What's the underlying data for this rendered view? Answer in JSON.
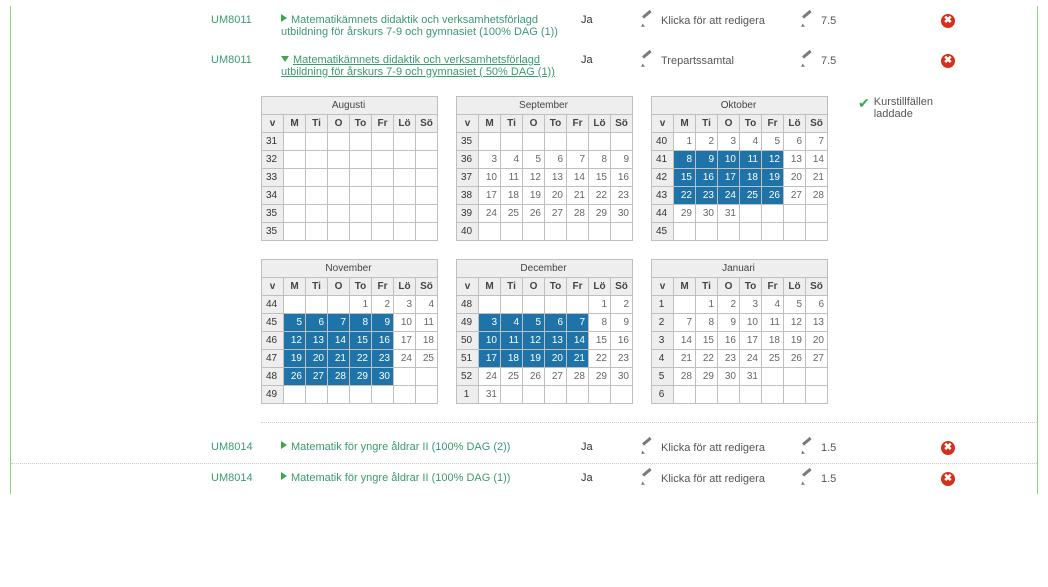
{
  "rows": {
    "r1": {
      "code": "UM8011",
      "title": "Matematikämnets didaktik och verksamhetsförlagd utbildning för årskurs 7-9 och gymnasiet (100% DAG (1))",
      "ja": "Ja",
      "action": "Klicka för att redigera",
      "hp": "7.5"
    },
    "r2": {
      "code": "UM8011",
      "title": "Matematikämnets didaktik och verksamhetsförlagd utbildning för årskurs 7-9 och gymnasiet ( 50% DAG (1))",
      "ja": "Ja",
      "action": "Trepartssamtal",
      "hp": "7.5"
    },
    "r3": {
      "code": "UM8014",
      "title": "Matematik för yngre åldrar II (100% DAG (2))",
      "ja": "Ja",
      "action": "Klicka för att redigera",
      "hp": "1.5"
    },
    "r4": {
      "code": "UM8014",
      "title": "Matematik för yngre åldrar II (100% DAG (1))",
      "ja": "Ja",
      "action": "Klicka för att redigera",
      "hp": "1.5"
    }
  },
  "status_label": "Kurstillfällen laddade",
  "weekdays": [
    "v",
    "M",
    "Ti",
    "O",
    "To",
    "Fr",
    "Lö",
    "Sö"
  ],
  "calendars": [
    {
      "name": "Augusti",
      "rows": [
        {
          "wk": "31",
          "d": [
            "",
            "",
            "",
            "",
            "",
            "",
            ""
          ]
        },
        {
          "wk": "32",
          "d": [
            "",
            "",
            "",
            "",
            "",
            "",
            ""
          ]
        },
        {
          "wk": "33",
          "d": [
            "",
            "",
            "",
            "",
            "",
            "",
            ""
          ]
        },
        {
          "wk": "34",
          "d": [
            "",
            "",
            "",
            "",
            "",
            "",
            ""
          ]
        },
        {
          "wk": "35",
          "d": [
            "",
            "",
            "",
            "",
            "",
            "",
            ""
          ]
        },
        {
          "wk": "35",
          "d": [
            "",
            "",
            "",
            "",
            "",
            "",
            ""
          ]
        }
      ],
      "hl": []
    },
    {
      "name": "September",
      "rows": [
        {
          "wk": "35",
          "d": [
            "",
            "",
            "",
            "",
            "",
            "",
            ""
          ]
        },
        {
          "wk": "36",
          "d": [
            "3",
            "4",
            "5",
            "6",
            "7",
            "8",
            "9"
          ]
        },
        {
          "wk": "37",
          "d": [
            "10",
            "11",
            "12",
            "13",
            "14",
            "15",
            "16"
          ]
        },
        {
          "wk": "38",
          "d": [
            "17",
            "18",
            "19",
            "20",
            "21",
            "22",
            "23"
          ]
        },
        {
          "wk": "39",
          "d": [
            "24",
            "25",
            "26",
            "27",
            "28",
            "29",
            "30"
          ]
        },
        {
          "wk": "40",
          "d": [
            "",
            "",
            "",
            "",
            "",
            "",
            ""
          ]
        }
      ],
      "hl": []
    },
    {
      "name": "Oktober",
      "rows": [
        {
          "wk": "40",
          "d": [
            "1",
            "2",
            "3",
            "4",
            "5",
            "6",
            "7"
          ]
        },
        {
          "wk": "41",
          "d": [
            "8",
            "9",
            "10",
            "11",
            "12",
            "13",
            "14"
          ]
        },
        {
          "wk": "42",
          "d": [
            "15",
            "16",
            "17",
            "18",
            "19",
            "20",
            "21"
          ]
        },
        {
          "wk": "43",
          "d": [
            "22",
            "23",
            "24",
            "25",
            "26",
            "27",
            "28"
          ]
        },
        {
          "wk": "44",
          "d": [
            "29",
            "30",
            "31",
            "",
            "",
            "",
            ""
          ]
        },
        {
          "wk": "45",
          "d": [
            "",
            "",
            "",
            "",
            "",
            "",
            ""
          ]
        }
      ],
      "hl": [
        [
          1,
          0
        ],
        [
          1,
          1
        ],
        [
          1,
          2
        ],
        [
          1,
          3
        ],
        [
          1,
          4
        ],
        [
          2,
          0
        ],
        [
          2,
          1
        ],
        [
          2,
          2
        ],
        [
          2,
          3
        ],
        [
          2,
          4
        ],
        [
          3,
          0
        ],
        [
          3,
          1
        ],
        [
          3,
          2
        ],
        [
          3,
          3
        ],
        [
          3,
          4
        ]
      ]
    },
    {
      "name": "November",
      "rows": [
        {
          "wk": "44",
          "d": [
            "",
            "",
            "",
            "1",
            "2",
            "3",
            "4"
          ]
        },
        {
          "wk": "45",
          "d": [
            "5",
            "6",
            "7",
            "8",
            "9",
            "10",
            "11"
          ]
        },
        {
          "wk": "46",
          "d": [
            "12",
            "13",
            "14",
            "15",
            "16",
            "17",
            "18"
          ]
        },
        {
          "wk": "47",
          "d": [
            "19",
            "20",
            "21",
            "22",
            "23",
            "24",
            "25"
          ]
        },
        {
          "wk": "48",
          "d": [
            "26",
            "27",
            "28",
            "29",
            "30",
            "",
            ""
          ]
        },
        {
          "wk": "49",
          "d": [
            "",
            "",
            "",
            "",
            "",
            "",
            ""
          ]
        }
      ],
      "hl": [
        [
          1,
          0
        ],
        [
          1,
          1
        ],
        [
          1,
          2
        ],
        [
          1,
          3
        ],
        [
          1,
          4
        ],
        [
          2,
          0
        ],
        [
          2,
          1
        ],
        [
          2,
          2
        ],
        [
          2,
          3
        ],
        [
          2,
          4
        ],
        [
          3,
          0
        ],
        [
          3,
          1
        ],
        [
          3,
          2
        ],
        [
          3,
          3
        ],
        [
          3,
          4
        ],
        [
          4,
          0
        ],
        [
          4,
          1
        ],
        [
          4,
          2
        ],
        [
          4,
          3
        ],
        [
          4,
          4
        ]
      ]
    },
    {
      "name": "December",
      "rows": [
        {
          "wk": "48",
          "d": [
            "",
            "",
            "",
            "",
            "",
            "1",
            "2"
          ]
        },
        {
          "wk": "49",
          "d": [
            "3",
            "4",
            "5",
            "6",
            "7",
            "8",
            "9"
          ]
        },
        {
          "wk": "50",
          "d": [
            "10",
            "11",
            "12",
            "13",
            "14",
            "15",
            "16"
          ]
        },
        {
          "wk": "51",
          "d": [
            "17",
            "18",
            "19",
            "20",
            "21",
            "22",
            "23"
          ]
        },
        {
          "wk": "52",
          "d": [
            "24",
            "25",
            "26",
            "27",
            "28",
            "29",
            "30"
          ]
        },
        {
          "wk": "1",
          "d": [
            "31",
            "",
            "",
            "",
            "",
            "",
            ""
          ]
        }
      ],
      "hl": [
        [
          1,
          0
        ],
        [
          1,
          1
        ],
        [
          1,
          2
        ],
        [
          1,
          3
        ],
        [
          1,
          4
        ],
        [
          2,
          0
        ],
        [
          2,
          1
        ],
        [
          2,
          2
        ],
        [
          2,
          3
        ],
        [
          2,
          4
        ],
        [
          3,
          0
        ],
        [
          3,
          1
        ],
        [
          3,
          2
        ],
        [
          3,
          3
        ],
        [
          3,
          4
        ]
      ]
    },
    {
      "name": "Januari",
      "rows": [
        {
          "wk": "1",
          "d": [
            "",
            "1",
            "2",
            "3",
            "4",
            "5",
            "6"
          ]
        },
        {
          "wk": "2",
          "d": [
            "7",
            "8",
            "9",
            "10",
            "11",
            "12",
            "13"
          ]
        },
        {
          "wk": "3",
          "d": [
            "14",
            "15",
            "16",
            "17",
            "18",
            "19",
            "20"
          ]
        },
        {
          "wk": "4",
          "d": [
            "21",
            "22",
            "23",
            "24",
            "25",
            "26",
            "27"
          ]
        },
        {
          "wk": "5",
          "d": [
            "28",
            "29",
            "30",
            "31",
            "",
            "",
            ""
          ]
        },
        {
          "wk": "6",
          "d": [
            "",
            "",
            "",
            "",
            "",
            "",
            ""
          ]
        }
      ],
      "hl": []
    }
  ]
}
